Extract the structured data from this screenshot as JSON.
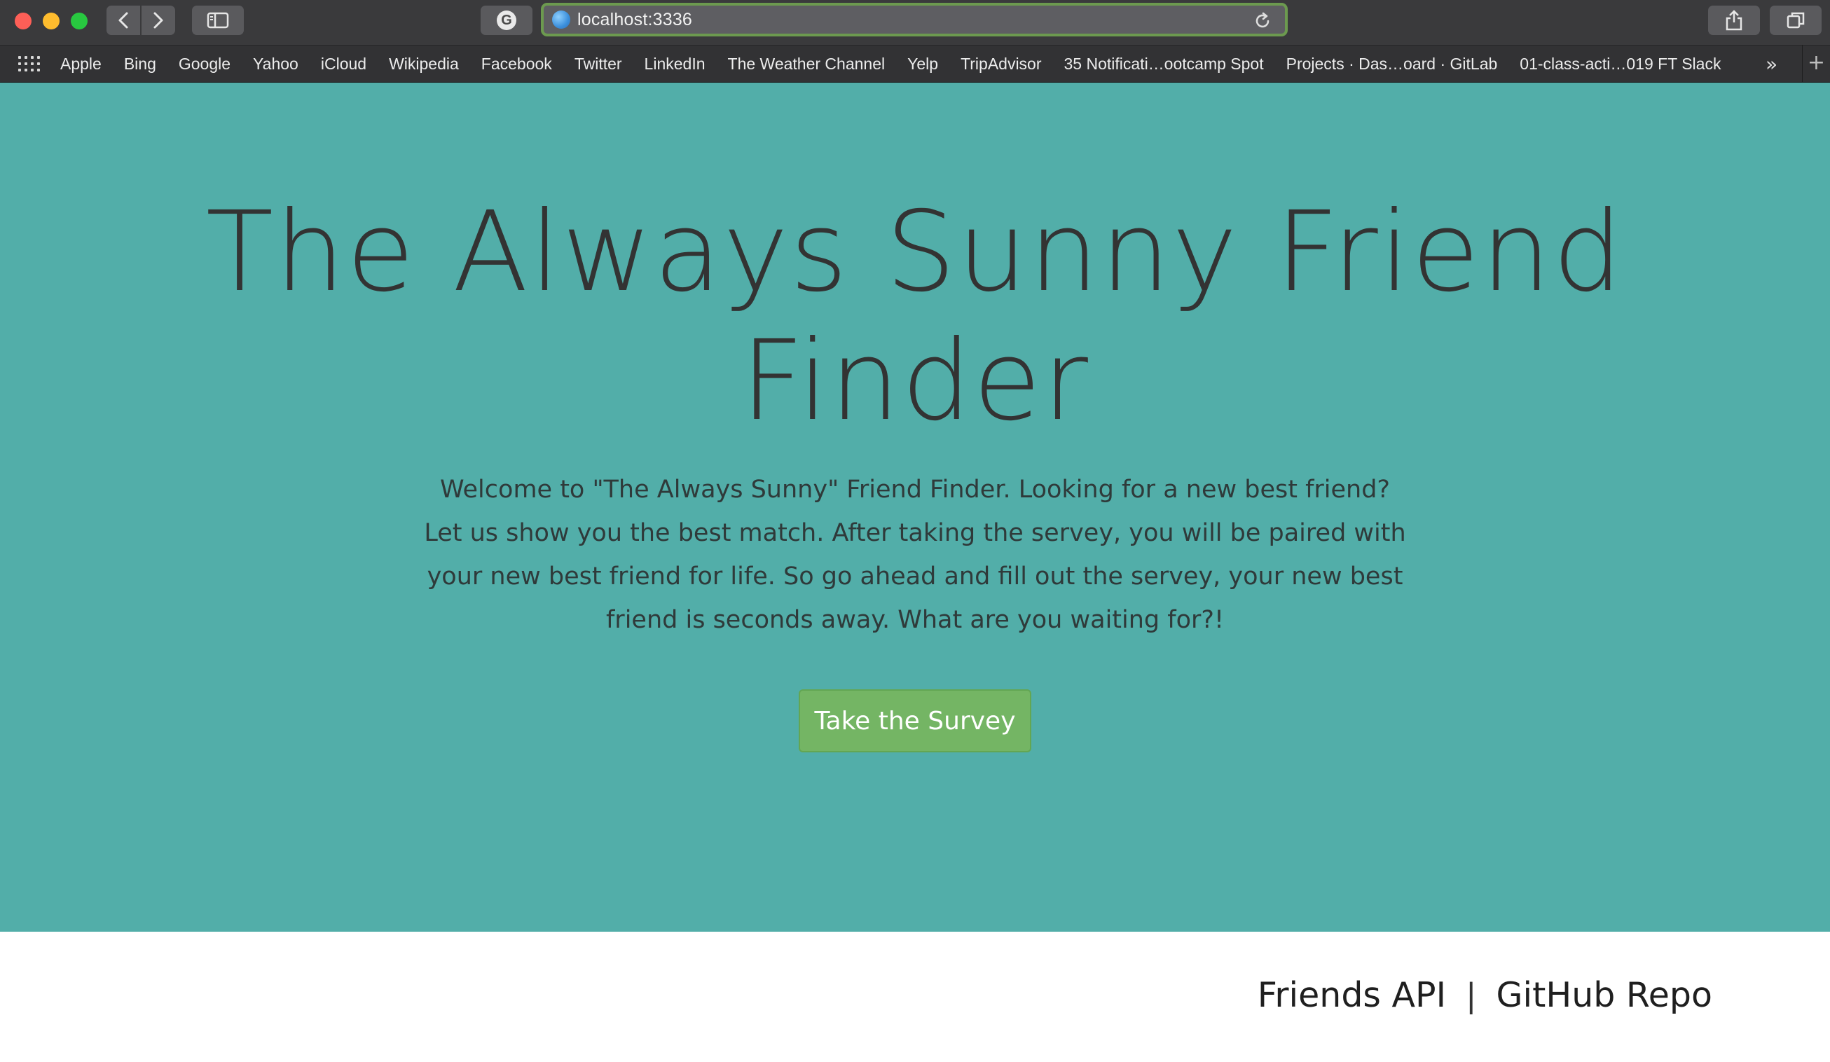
{
  "browser": {
    "url": "localhost:3336",
    "bookmarks": [
      "Apple",
      "Bing",
      "Google",
      "Yahoo",
      "iCloud",
      "Wikipedia",
      "Facebook",
      "Twitter",
      "LinkedIn",
      "The Weather Channel",
      "Yelp",
      "TripAdvisor",
      "35 Notificati…ootcamp Spot",
      "Projects · Das…oard · GitLab",
      "01-class-acti…019 FT Slack"
    ],
    "more_label": "»",
    "add_label": "+"
  },
  "hero": {
    "title": "The Always Sunny Friend Finder",
    "description": "Welcome to \"The Always Sunny\" Friend Finder. Looking for a new best friend? Let us show you the best match. After taking the servey, you will be paired with your new best friend for life. So go ahead and fill out the servey, your new best friend is seconds away. What are you waiting for?!",
    "button_label": "Take the Survey",
    "background": "#52aea9",
    "button_color": "#74b564"
  },
  "footer": {
    "links": [
      "Friends API",
      "GitHub Repo"
    ],
    "separator": "|"
  }
}
